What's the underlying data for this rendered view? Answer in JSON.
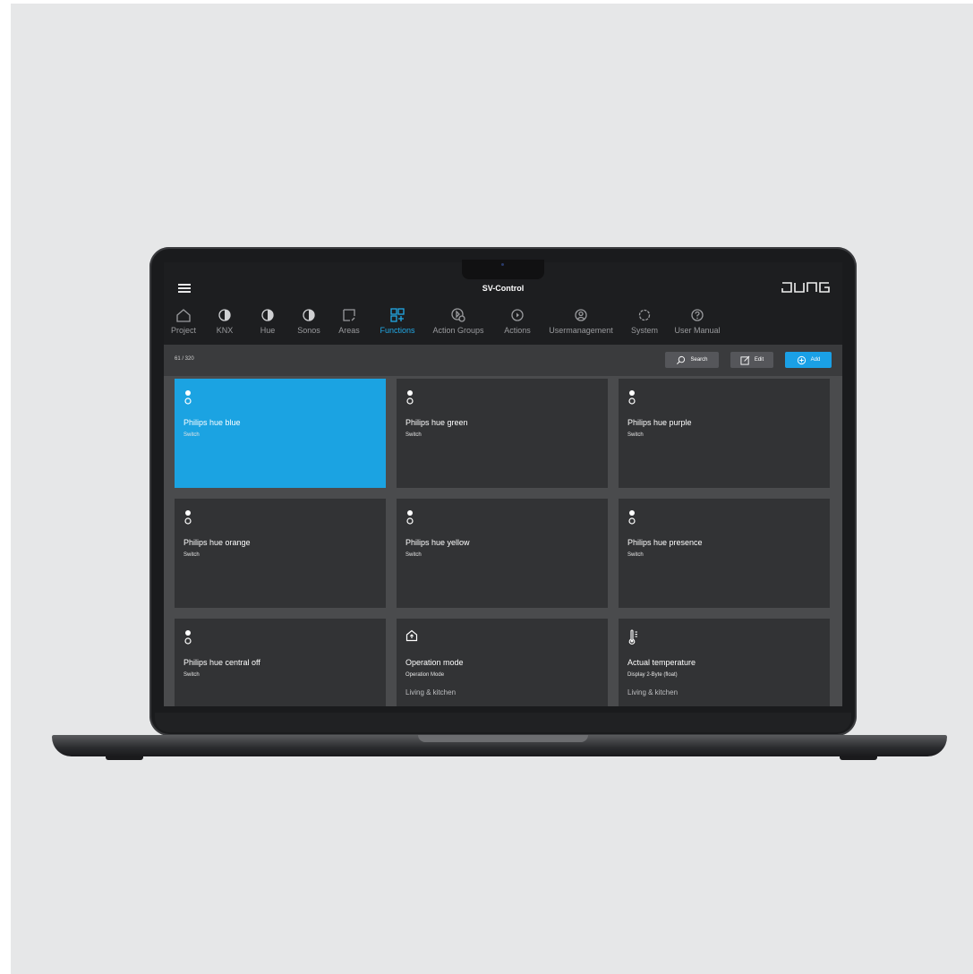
{
  "app": {
    "title": "SV-Control",
    "brand": "JUNG"
  },
  "nav": [
    {
      "label": "Project",
      "icon": "home-icon"
    },
    {
      "label": "KNX",
      "icon": "half-circle-icon"
    },
    {
      "label": "Hue",
      "icon": "half-circle-icon"
    },
    {
      "label": "Sonos",
      "icon": "half-circle-icon"
    },
    {
      "label": "Areas",
      "icon": "area-icon"
    },
    {
      "label": "Functions",
      "icon": "functions-grid-icon",
      "active": true
    },
    {
      "label": "Action Groups",
      "icon": "action-groups-icon"
    },
    {
      "label": "Actions",
      "icon": "play-circle-icon"
    },
    {
      "label": "Usermanagement",
      "icon": "user-circle-icon"
    },
    {
      "label": "System",
      "icon": "gear-icon"
    },
    {
      "label": "User Manual",
      "icon": "help-icon"
    }
  ],
  "toolbar": {
    "counter": "61 / 320",
    "search_label": "Search",
    "edit_label": "Edit",
    "add_label": "Add"
  },
  "cards": [
    {
      "title": "Philips hue blue",
      "subtitle": "Switch",
      "area": "",
      "icon": "switch-icon",
      "selected": true
    },
    {
      "title": "Philips hue green",
      "subtitle": "Switch",
      "area": "",
      "icon": "switch-icon"
    },
    {
      "title": "Philips hue purple",
      "subtitle": "Switch",
      "area": "",
      "icon": "switch-icon"
    },
    {
      "title": "Philips hue orange",
      "subtitle": "Switch",
      "area": "",
      "icon": "switch-icon"
    },
    {
      "title": "Philips hue yellow",
      "subtitle": "Switch",
      "area": "",
      "icon": "switch-icon"
    },
    {
      "title": "Philips hue presence",
      "subtitle": "Switch",
      "area": "",
      "icon": "switch-icon"
    },
    {
      "title": "Philips hue central off",
      "subtitle": "Switch",
      "area": "",
      "icon": "switch-icon"
    },
    {
      "title": "Operation mode",
      "subtitle": "Operation Mode",
      "area": "Living & kitchen",
      "icon": "house-mode-icon"
    },
    {
      "title": "Actual temperature",
      "subtitle": "Display 2-Byte (float)",
      "area": "Living & kitchen",
      "icon": "thermometer-icon"
    }
  ],
  "colors": {
    "accent": "#1ba3e2",
    "card": "#323335",
    "bar": "#1d1e20"
  }
}
